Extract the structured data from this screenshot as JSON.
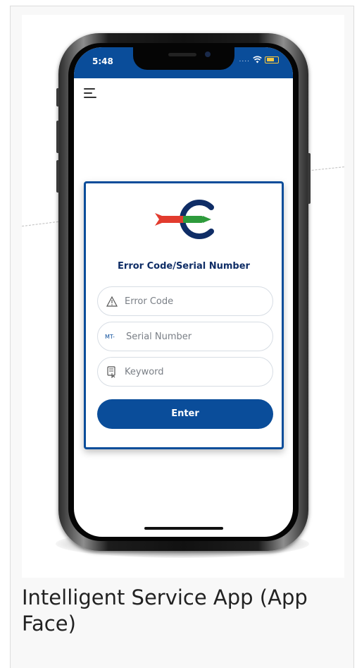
{
  "phone": {
    "status_time": "5:48",
    "status_dots": "....",
    "form_title": "Error Code/Serial Number",
    "fields": {
      "error_code_placeholder": "Error Code",
      "serial_prefix": "MT-",
      "serial_placeholder": "Serial Number",
      "keyword_placeholder": "Keyword"
    },
    "enter_label": "Enter"
  },
  "caption": "Intelligent Service App (App Face)",
  "colors": {
    "brand_blue": "#0a4d9a",
    "title_navy": "#0f2d66",
    "logo_red": "#e23b2e",
    "logo_green": "#2e9b3c"
  },
  "icons": {
    "menu": "hamburger-icon",
    "error_code": "warning-triangle-icon",
    "keyword": "keyword-doc-icon",
    "wifi": "wifi-icon",
    "battery": "battery-charging-icon"
  }
}
